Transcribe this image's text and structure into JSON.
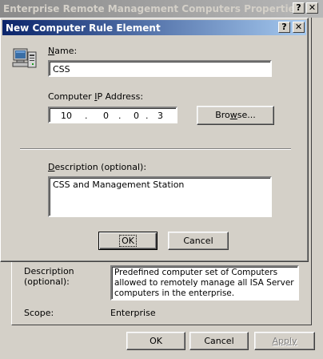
{
  "back_window": {
    "title": "Enterprise Remote Management Computers Properties",
    "help_glyph": "?",
    "close_glyph": "✕",
    "description_label_line1": "Description",
    "description_label_line2": "(optional):",
    "description_value": "Predefined computer set of Computers allowed to remotely manage all ISA Server computers in the enterprise.",
    "scope_label": "Scope:",
    "scope_value": "Enterprise",
    "ok_label": "OK",
    "cancel_label": "Cancel",
    "apply_label": "Apply"
  },
  "dialog": {
    "title": "New Computer Rule Element",
    "help_glyph": "?",
    "close_glyph": "✕",
    "name_label_pre": "",
    "name_label_ul": "N",
    "name_label_post": "ame:",
    "name_value": "CSS",
    "ip_label_pre": "Computer ",
    "ip_label_ul": "I",
    "ip_label_post": "P Address:",
    "ip_octets": [
      "10",
      "0",
      "0",
      "3"
    ],
    "ip_dot": ".",
    "browse_pre": "Bro",
    "browse_ul": "w",
    "browse_post": "se...",
    "description_pre": "",
    "description_ul": "D",
    "description_post": "escription (optional):",
    "description_value": "CSS and Management Station",
    "ok_label": "OK",
    "cancel_label": "Cancel"
  }
}
